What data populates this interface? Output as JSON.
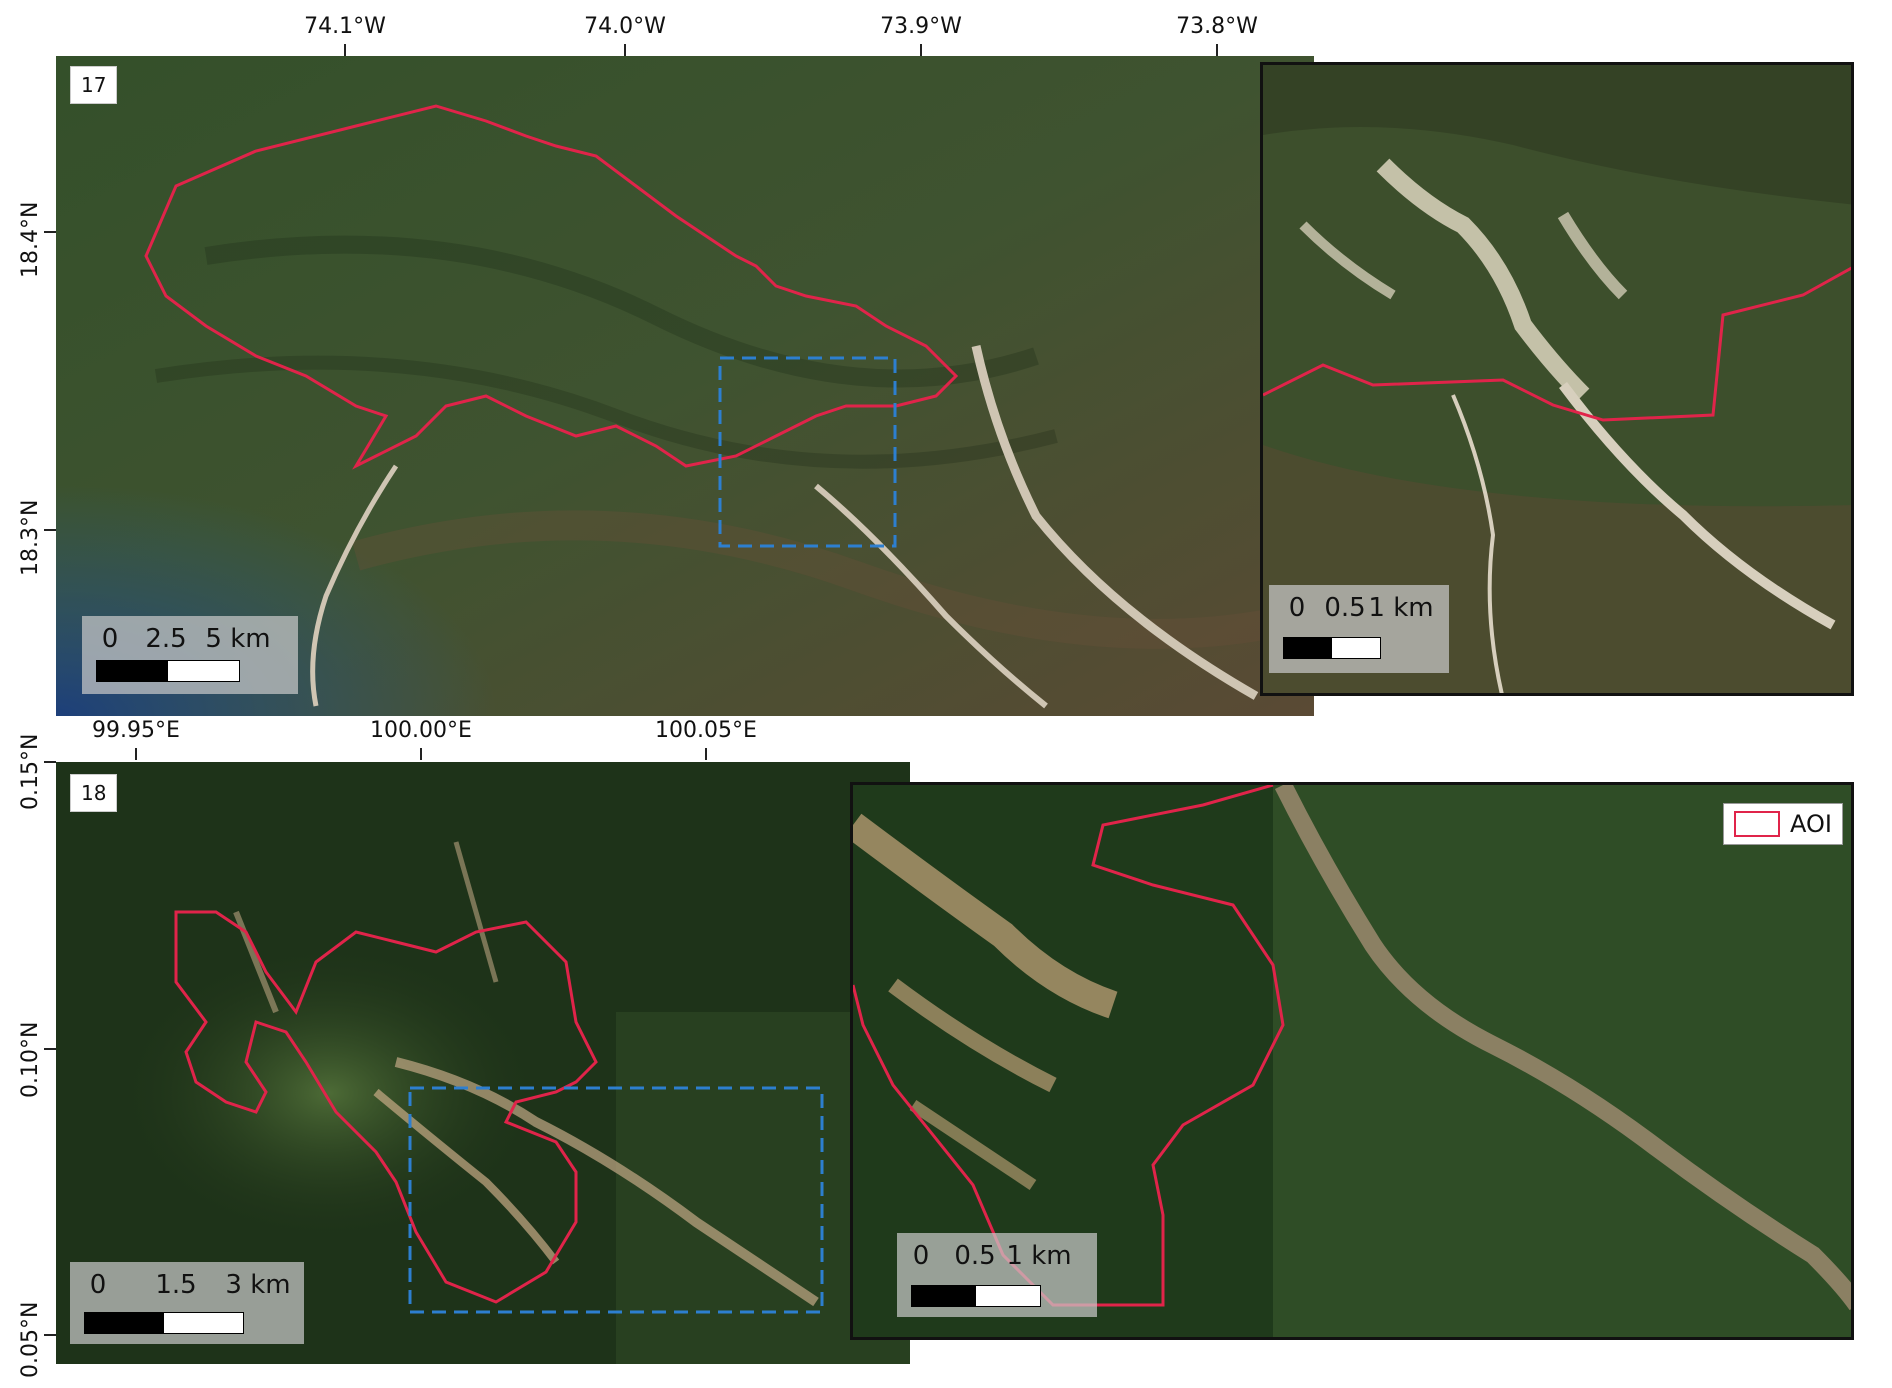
{
  "panel17": {
    "label": "17",
    "x_ticks": [
      "74.1°W",
      "74.0°W",
      "73.9°W",
      "73.8°W"
    ],
    "y_ticks": [
      "18.4°N",
      "18.3°N"
    ],
    "scale_main": [
      "0",
      "2.5",
      "5 km"
    ],
    "scale_inset": [
      "0",
      "0.5",
      "1 km"
    ]
  },
  "panel18": {
    "label": "18",
    "x_ticks": [
      "99.95°E",
      "100.00°E",
      "100.05°E"
    ],
    "y_ticks": [
      "0.15°N",
      "0.10°N",
      "0.05°N"
    ],
    "scale_main": [
      "0",
      "1.5",
      "3 km"
    ],
    "scale_inset": [
      "0",
      "0.5",
      "1 km"
    ]
  },
  "legend": {
    "label": "AOI",
    "color": "#e0244a"
  },
  "colors": {
    "aoi": "#e0244a",
    "inset_box": "#2d7fd0",
    "vegetation": "#2f4a24",
    "river": "#c9bfae"
  }
}
